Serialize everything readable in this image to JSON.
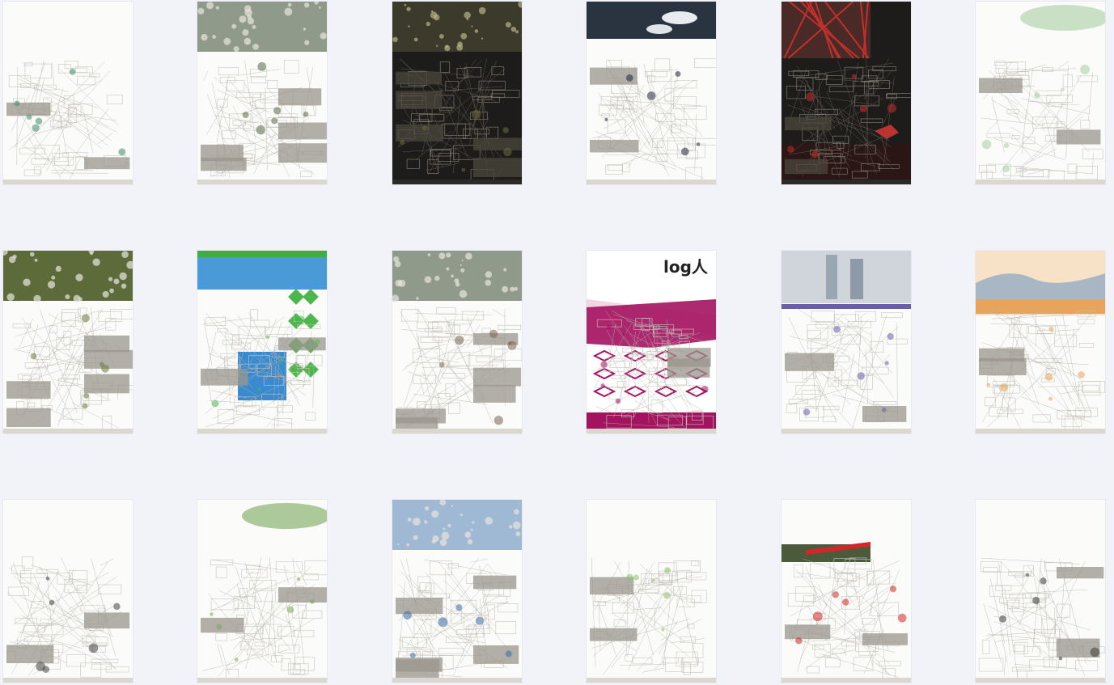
{
  "gallery": {
    "rows": 3,
    "columns": 6,
    "posters": [
      {
        "name": "poster-river-masterplan",
        "theme": "white-map",
        "accent": "#3c8c6a"
      },
      {
        "name": "poster-hillside-campus",
        "theme": "white-photo",
        "accent": "#5a6a4a"
      },
      {
        "name": "poster-night-village",
        "theme": "dark-photo",
        "accent": "#6b6a3a"
      },
      {
        "name": "poster-floating-pavilions",
        "theme": "white-sky",
        "accent": "#1f2a36"
      },
      {
        "name": "poster-red-structure",
        "theme": "dark-red",
        "accent": "#c0302c"
      },
      {
        "name": "poster-green-park",
        "theme": "white-green",
        "accent": "#a8cfa0"
      },
      {
        "name": "poster-aerial-site",
        "theme": "aerial",
        "accent": "#6b7a3a"
      },
      {
        "name": "poster-green-towers",
        "theme": "green",
        "accent": "#4cb84c"
      },
      {
        "name": "poster-town-renewal",
        "theme": "white-photo",
        "accent": "#7a6450"
      },
      {
        "name": "poster-log-magenta",
        "theme": "magenta",
        "accent": "#a3135f",
        "title": "log人"
      },
      {
        "name": "poster-highrise-purple",
        "theme": "white-purple",
        "accent": "#6a5fa5"
      },
      {
        "name": "poster-orange-landscape",
        "theme": "orange",
        "accent": "#e8a45a"
      },
      {
        "name": "poster-grid-isometric",
        "theme": "white-lines",
        "accent": "#444"
      },
      {
        "name": "poster-white-hill",
        "theme": "white-green",
        "accent": "#78a85a"
      },
      {
        "name": "poster-blue-elevation",
        "theme": "white-blue",
        "accent": "#3a6aa8"
      },
      {
        "name": "poster-sketch-green",
        "theme": "white-sketch",
        "accent": "#8fbf6f"
      },
      {
        "name": "poster-red-roof",
        "theme": "white-redroof",
        "accent": "#d0282a"
      },
      {
        "name": "poster-exploded-axon",
        "theme": "white-axon",
        "accent": "#3a3a3a"
      }
    ]
  }
}
